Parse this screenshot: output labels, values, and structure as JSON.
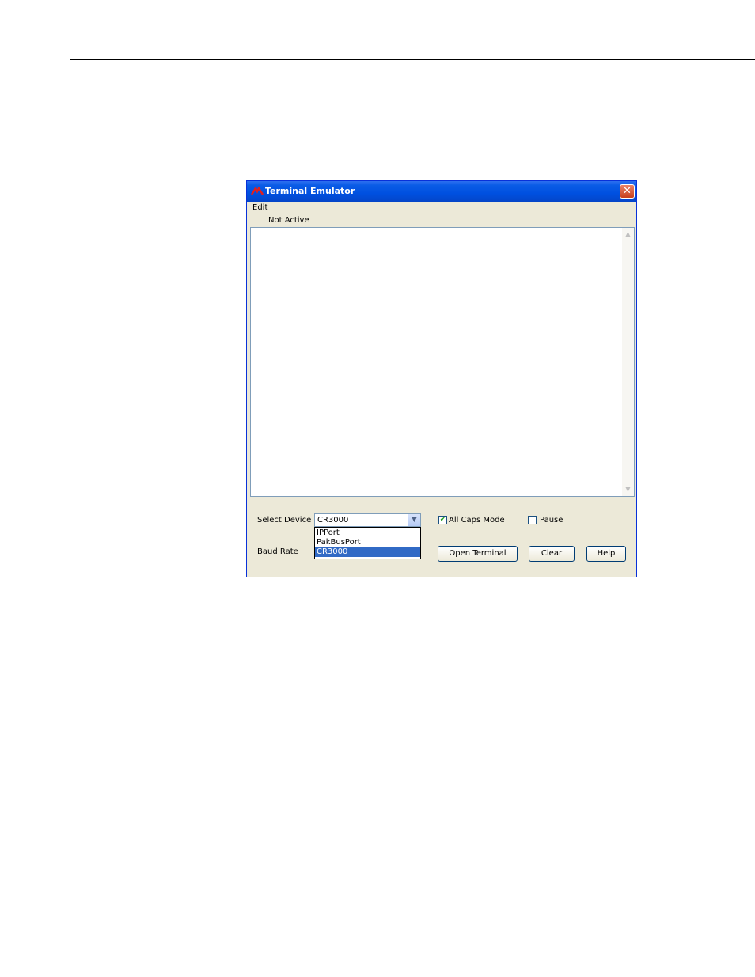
{
  "window": {
    "title": "Terminal Emulator",
    "close_label": "✕",
    "menu": {
      "edit": "Edit"
    },
    "status": "Not Active"
  },
  "controls": {
    "select_device_label": "Select Device",
    "selected_device": "CR3000",
    "device_options": [
      "IPPort",
      "PakBusPort",
      "CR3000"
    ],
    "baud_rate_label": "Baud Rate",
    "all_caps_label": "All Caps Mode",
    "all_caps_checked": true,
    "pause_label": "Pause",
    "pause_checked": false,
    "open_terminal_label": "Open Terminal",
    "clear_label": "Clear",
    "help_label": "Help"
  },
  "colors": {
    "titlebar": "#0050e0",
    "selection": "#316ac5",
    "dialog_bg": "#ece9d8"
  }
}
